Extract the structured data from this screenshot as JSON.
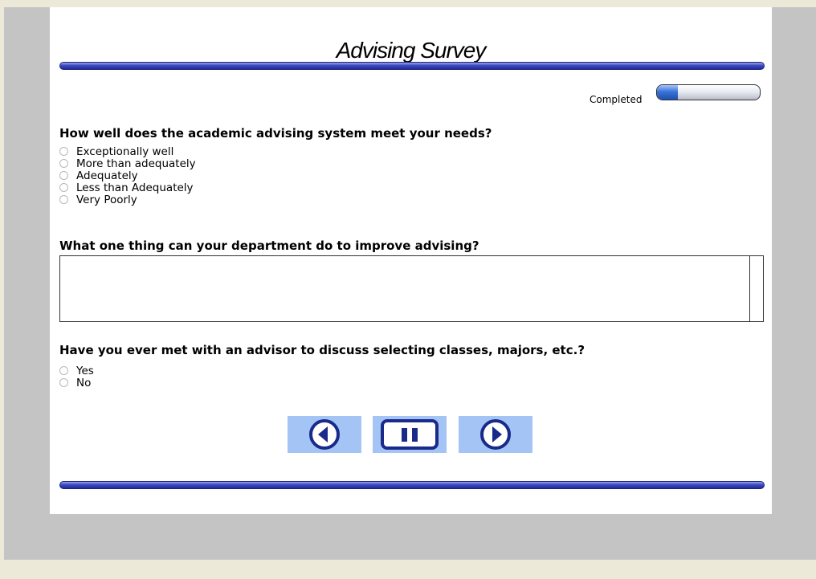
{
  "survey": {
    "title": "Advising Survey",
    "progress": {
      "label": "Completed",
      "fraction": 0.2
    }
  },
  "questions": [
    {
      "text": "How well does the academic advising system meet your needs?",
      "options": [
        "Exceptionally well",
        "More than adequately",
        "Adequately",
        "Less than Adequately",
        "Very Poorly"
      ]
    },
    {
      "text": "What one thing can your department do to improve advising?",
      "answer_value": ""
    },
    {
      "text": "Have you ever met with an advisor to discuss selecting classes, majors, etc.?",
      "options": [
        "Yes",
        "No"
      ]
    }
  ],
  "navigation": {
    "prev_icon": "previous-arrow-icon",
    "pause_icon": "pause-icon",
    "next_icon": "next-arrow-icon",
    "button_color": "#a3c4f5",
    "icon_color": "#1a2a8a"
  }
}
